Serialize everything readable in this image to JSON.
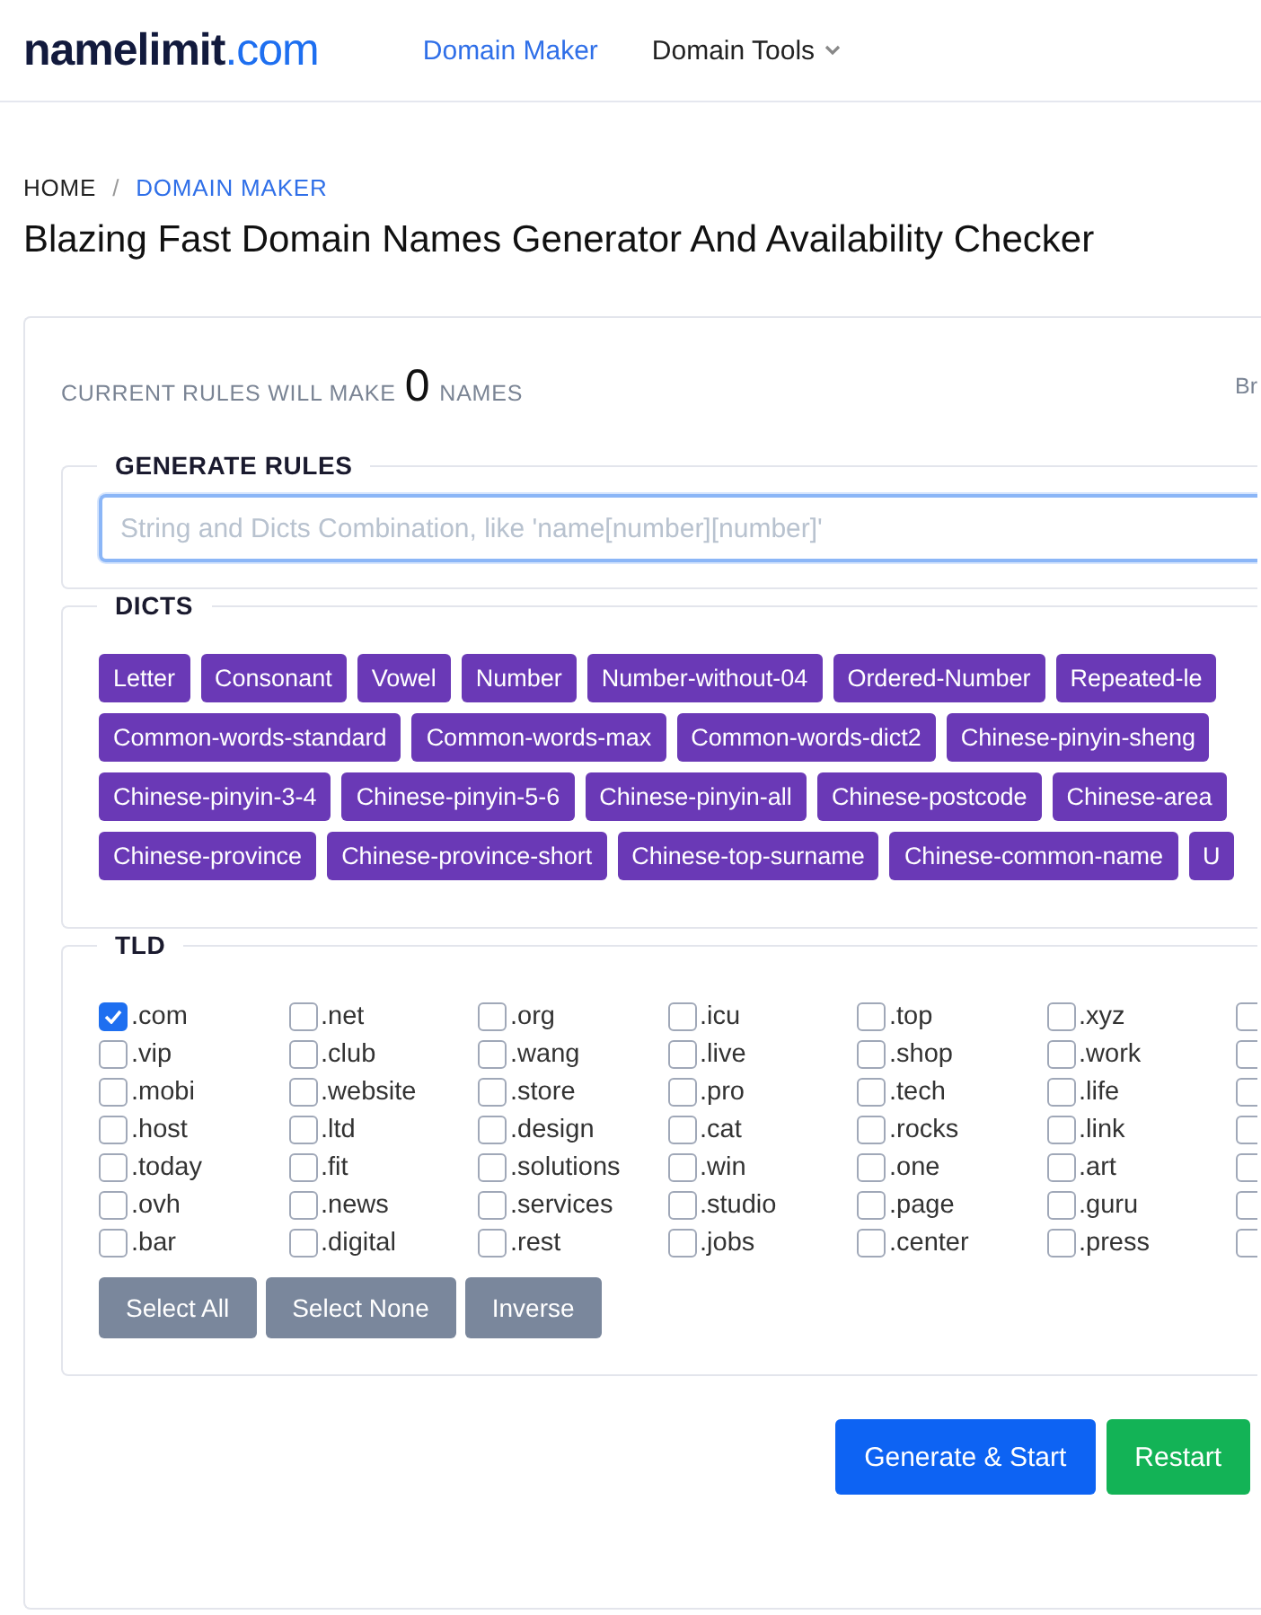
{
  "header": {
    "logo": {
      "name": "namelimit",
      "suffix": ".com"
    },
    "nav": [
      {
        "label": "Domain Maker",
        "selected": true,
        "has_menu": false
      },
      {
        "label": "Domain Tools",
        "selected": false,
        "has_menu": true
      }
    ]
  },
  "breadcrumb": {
    "separator": "/",
    "items": [
      {
        "label": "HOME",
        "selected": false
      },
      {
        "label": "DOMAIN MAKER",
        "selected": true
      }
    ]
  },
  "title": "Blazing Fast Domain Names Generator And Availability Checker",
  "summary": {
    "prefix": "CURRENT RULES WILL MAKE",
    "count": "0",
    "suffix": "NAMES",
    "corner_text": "Br"
  },
  "generate_rules": {
    "legend": "GENERATE RULES",
    "placeholder": "String and Dicts Combination, like 'name[number][number]'"
  },
  "dicts": {
    "legend": "DICTS",
    "tags": [
      "Letter",
      "Consonant",
      "Vowel",
      "Number",
      "Number-without-04",
      "Ordered-Number",
      "Repeated-le",
      "Common-words-standard",
      "Common-words-max",
      "Common-words-dict2",
      "Chinese-pinyin-sheng",
      "Chinese-pinyin-3-4",
      "Chinese-pinyin-5-6",
      "Chinese-pinyin-all",
      "Chinese-postcode",
      "Chinese-area",
      "Chinese-province",
      "Chinese-province-short",
      "Chinese-top-surname",
      "Chinese-common-name",
      "U"
    ]
  },
  "tld": {
    "legend": "TLD",
    "rows": [
      [
        {
          "label": ".com",
          "checked": true
        },
        {
          "label": ".net",
          "checked": false
        },
        {
          "label": ".org",
          "checked": false
        },
        {
          "label": ".icu",
          "checked": false
        },
        {
          "label": ".top",
          "checked": false
        },
        {
          "label": ".xyz",
          "checked": false
        },
        {
          "checked": false
        }
      ],
      [
        {
          "label": ".vip",
          "checked": false
        },
        {
          "label": ".club",
          "checked": false
        },
        {
          "label": ".wang",
          "checked": false
        },
        {
          "label": ".live",
          "checked": false
        },
        {
          "label": ".shop",
          "checked": false
        },
        {
          "label": ".work",
          "checked": false
        },
        {
          "checked": false
        }
      ],
      [
        {
          "label": ".mobi",
          "checked": false
        },
        {
          "label": ".website",
          "checked": false
        },
        {
          "label": ".store",
          "checked": false
        },
        {
          "label": ".pro",
          "checked": false
        },
        {
          "label": ".tech",
          "checked": false
        },
        {
          "label": ".life",
          "checked": false
        },
        {
          "checked": false
        }
      ],
      [
        {
          "label": ".host",
          "checked": false
        },
        {
          "label": ".ltd",
          "checked": false
        },
        {
          "label": ".design",
          "checked": false
        },
        {
          "label": ".cat",
          "checked": false
        },
        {
          "label": ".rocks",
          "checked": false
        },
        {
          "label": ".link",
          "checked": false
        },
        {
          "checked": false
        }
      ],
      [
        {
          "label": ".today",
          "checked": false
        },
        {
          "label": ".fit",
          "checked": false
        },
        {
          "label": ".solutions",
          "checked": false
        },
        {
          "label": ".win",
          "checked": false
        },
        {
          "label": ".one",
          "checked": false
        },
        {
          "label": ".art",
          "checked": false
        },
        {
          "checked": false
        }
      ],
      [
        {
          "label": ".ovh",
          "checked": false
        },
        {
          "label": ".news",
          "checked": false
        },
        {
          "label": ".services",
          "checked": false
        },
        {
          "label": ".studio",
          "checked": false
        },
        {
          "label": ".page",
          "checked": false
        },
        {
          "label": ".guru",
          "checked": false
        },
        {
          "checked": false
        }
      ],
      [
        {
          "label": ".bar",
          "checked": false
        },
        {
          "label": ".digital",
          "checked": false
        },
        {
          "label": ".rest",
          "checked": false
        },
        {
          "label": ".jobs",
          "checked": false
        },
        {
          "label": ".center",
          "checked": false
        },
        {
          "label": ".press",
          "checked": false
        },
        {
          "checked": false
        }
      ]
    ],
    "buttons": [
      "Select All",
      "Select None",
      "Inverse"
    ]
  },
  "actions": [
    {
      "label": "Generate & Start",
      "kind": "primary"
    },
    {
      "label": "Restart",
      "kind": "success"
    }
  ]
}
